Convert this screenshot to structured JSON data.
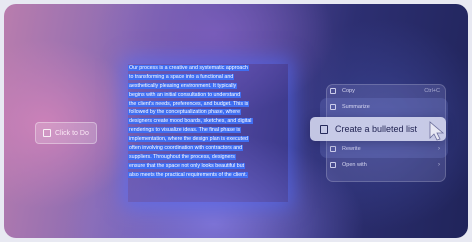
{
  "action_pill": {
    "label": "Click to Do",
    "icon": "click-to-do-icon"
  },
  "selected_text": {
    "lines": [
      "Our process is a creative and systematic approach",
      "to transforming a space into a functional and",
      "aesthetically pleasing environment. It typically",
      "begins with an initial consultation to understand",
      "the client's needs, preferences, and budget. This is",
      "followed by the conceptualization phase, where",
      "designers create mood boards, sketches, and digital",
      "renderings to visualize ideas. The final phase is",
      "implementation, where the design plan is executed",
      "often involving coordination with contractors and",
      "suppliers. Throughout the process, designers",
      "ensure that the space not only looks beautiful but",
      "also meets the practical requirements of the client."
    ]
  },
  "context_menu": {
    "copy": {
      "label": "Copy",
      "shortcut": "Ctrl+C",
      "icon": "copy-icon"
    },
    "summarize": {
      "label": "Summarize",
      "icon": "summarize-icon"
    },
    "bulleted": {
      "label": "Create a bulleted list",
      "icon": "list-icon"
    },
    "rewrite": {
      "label": "Rewrite",
      "icon": "rewrite-icon"
    },
    "open_with": {
      "label": "Open with",
      "icon": "open-with-icon"
    }
  }
}
